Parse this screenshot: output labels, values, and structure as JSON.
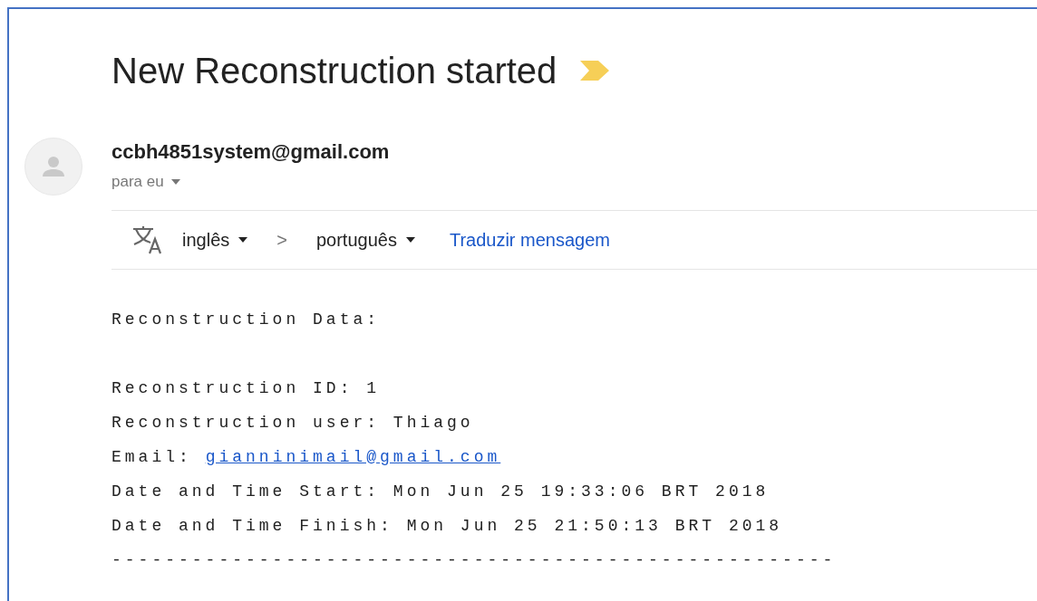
{
  "subject": "New Reconstruction started",
  "importance_marker": true,
  "sender": {
    "email": "ccbh4851system@gmail.com",
    "recipient": "para eu"
  },
  "translate_bar": {
    "from": "inglês",
    "separator": ">",
    "to": "português",
    "action": "Traduzir mensagem"
  },
  "body": [
    {
      "kind": "text",
      "text": "Reconstruction Data:"
    },
    {
      "kind": "blank"
    },
    {
      "kind": "text",
      "text": "Reconstruction ID: 1"
    },
    {
      "kind": "text",
      "text": "Reconstruction user: Thiago"
    },
    {
      "kind": "link",
      "text": "Email:",
      "link": "gianninimail@gmail.com"
    },
    {
      "kind": "text",
      "text": "Date and Time Start: Mon Jun 25 19:33:06 BRT 2018"
    },
    {
      "kind": "text",
      "text": "Date and Time Finish: Mon Jun 25 21:50:13 BRT 2018"
    },
    {
      "kind": "text",
      "text": "------------------------------------------------------"
    }
  ]
}
